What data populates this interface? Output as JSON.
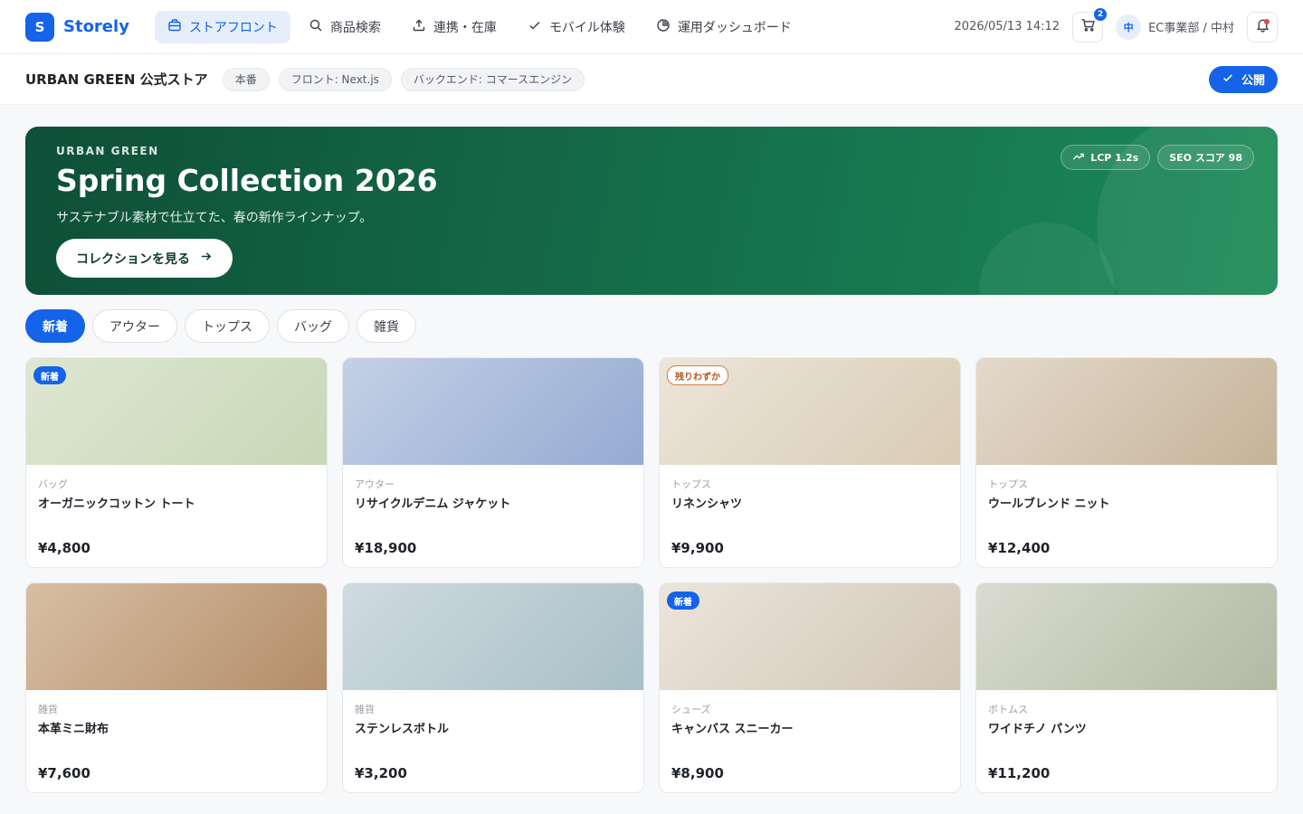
{
  "app": {
    "logo_letter": "S",
    "name": "Storely"
  },
  "nav": {
    "items": [
      {
        "label": "ストアフロント",
        "icon": "storefront-icon",
        "active": true
      },
      {
        "label": "商品検索",
        "icon": "search-icon",
        "active": false
      },
      {
        "label": "連携・在庫",
        "icon": "upload-icon",
        "active": false
      },
      {
        "label": "モバイル体験",
        "icon": "check-icon",
        "active": false
      },
      {
        "label": "運用ダッシュボード",
        "icon": "pie-chart-icon",
        "active": false
      }
    ],
    "datetime": "2026/05/13 14:12",
    "cart_count": "2",
    "user_initial": "中",
    "user_name": "EC事業部 / 中村"
  },
  "subheader": {
    "store_title": "URBAN GREEN 公式ストア",
    "chips": [
      "本番",
      "フロント: Next.js",
      "バックエンド: コマースエンジン"
    ],
    "publish_label": "公開"
  },
  "hero": {
    "eyebrow": "URBAN GREEN",
    "title": "Spring Collection 2026",
    "subtitle": "サステナブル素材で仕立てた、春の新作ラインナップ。",
    "cta_label": "コレクションを見る",
    "metrics": [
      {
        "label": "LCP 1.2s",
        "icon": "trend-up-icon"
      },
      {
        "label": "SEO スコア 98",
        "icon": ""
      }
    ]
  },
  "categories": [
    {
      "label": "新着",
      "active": true
    },
    {
      "label": "アウター",
      "active": false
    },
    {
      "label": "トップス",
      "active": false
    },
    {
      "label": "バッグ",
      "active": false
    },
    {
      "label": "雑貨",
      "active": false
    }
  ],
  "products": [
    {
      "category": "バッグ",
      "name": "オーガニックコットン トート",
      "price": "¥4,800",
      "badge": "新着",
      "badge_type": "new",
      "colors": [
        "#dde6d2",
        "#c7d8b6"
      ]
    },
    {
      "category": "アウター",
      "name": "リサイクルデニム ジャケット",
      "price": "¥18,900",
      "badge": "",
      "badge_type": "",
      "colors": [
        "#c4d0e6",
        "#94abd2"
      ]
    },
    {
      "category": "トップス",
      "name": "リネンシャツ",
      "price": "¥9,900",
      "badge": "残りわずか",
      "badge_type": "low",
      "colors": [
        "#ece5d9",
        "#d9ccb5"
      ]
    },
    {
      "category": "トップス",
      "name": "ウールブレンド ニット",
      "price": "¥12,400",
      "badge": "",
      "badge_type": "",
      "colors": [
        "#e4d9cb",
        "#c5b398"
      ]
    },
    {
      "category": "雑貨",
      "name": "本革ミニ財布",
      "price": "¥7,600",
      "badge": "",
      "badge_type": "",
      "colors": [
        "#d7bfa3",
        "#b48d68"
      ]
    },
    {
      "category": "雑貨",
      "name": "ステンレスボトル",
      "price": "¥3,200",
      "badge": "",
      "badge_type": "",
      "colors": [
        "#cfdbe0",
        "#a8bfc7"
      ]
    },
    {
      "category": "シューズ",
      "name": "キャンバス スニーカー",
      "price": "¥8,900",
      "badge": "新着",
      "badge_type": "new",
      "colors": [
        "#ebe5dc",
        "#d2c6b5"
      ]
    },
    {
      "category": "ボトムス",
      "name": "ワイドチノ パンツ",
      "price": "¥11,200",
      "badge": "",
      "badge_type": "",
      "colors": [
        "#d9dccf",
        "#b2b9a3"
      ]
    }
  ]
}
